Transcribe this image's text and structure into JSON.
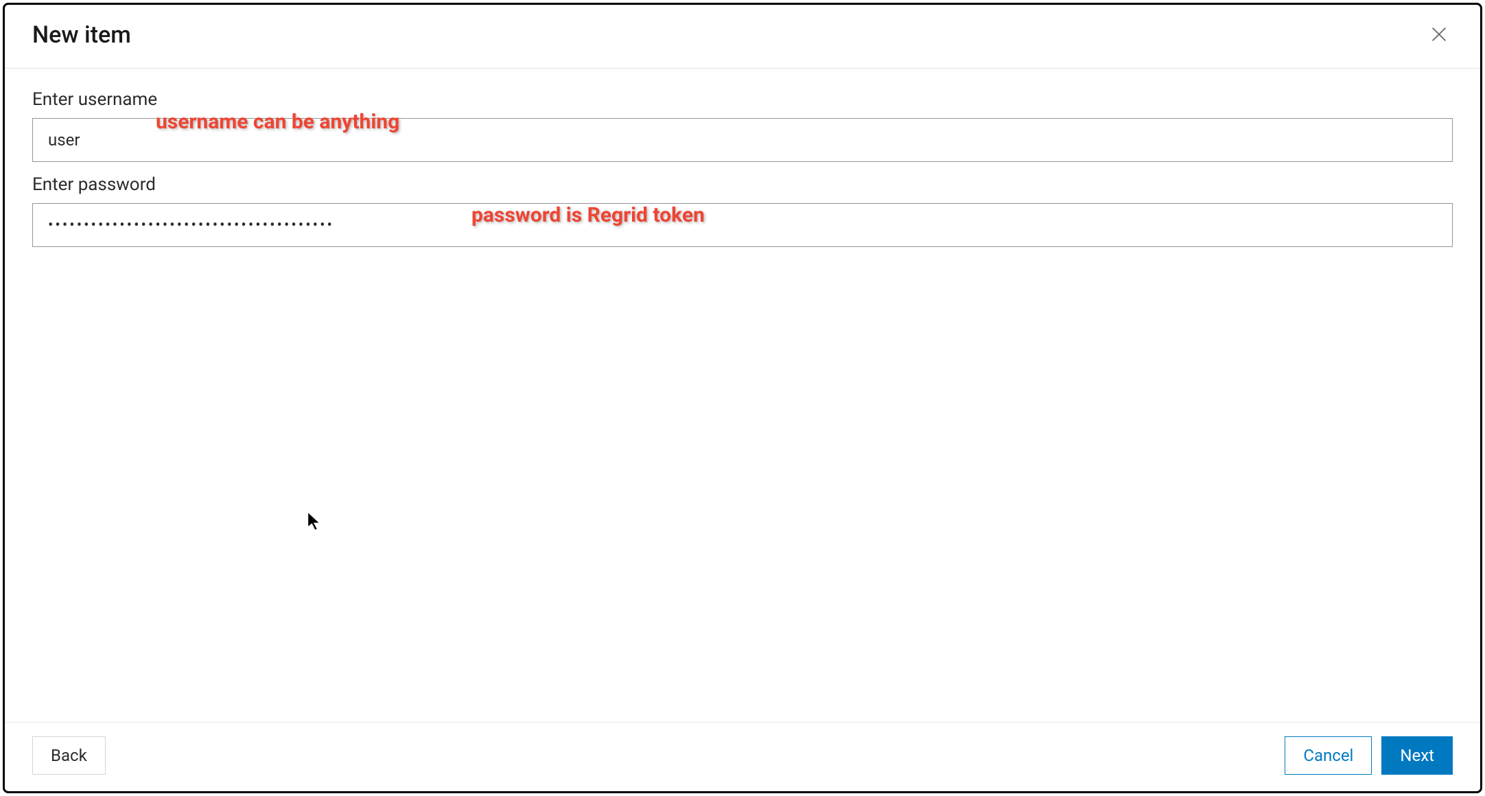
{
  "dialog": {
    "title": "New item",
    "close_label": "Close"
  },
  "form": {
    "username_label": "Enter username",
    "username_value": "user",
    "password_label": "Enter password",
    "password_value": "••••••••••••••••••••••••••••••••••••••••"
  },
  "annotations": {
    "username_hint": "username can be anything",
    "password_hint": "password is Regrid token"
  },
  "footer": {
    "back_label": "Back",
    "cancel_label": "Cancel",
    "next_label": "Next"
  },
  "colors": {
    "primary": "#0079c1",
    "annotation": "#ee4433"
  }
}
